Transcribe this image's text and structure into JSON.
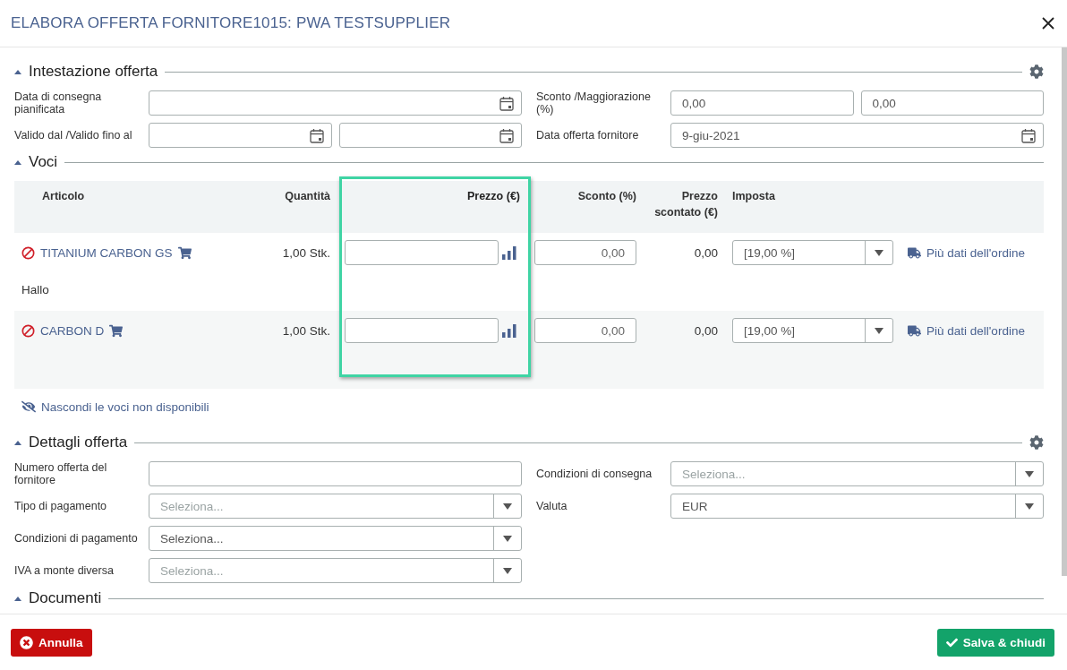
{
  "dialog": {
    "title": "ELABORA OFFERTA FORNITORE1015: PWA TESTSUPPLIER"
  },
  "header_section": {
    "title": "Intestazione offerta",
    "expanded": true,
    "left_fields": [
      {
        "label": "Data di consegna pianificata",
        "inputs": [
          {
            "kind": "date"
          }
        ]
      },
      {
        "label": "Valido dal /Valido fino al",
        "inputs": [
          {
            "kind": "date"
          },
          {
            "kind": "date"
          }
        ]
      }
    ],
    "right_fields": [
      {
        "label": "Sconto /Maggiorazione (%)",
        "inputs": [
          {
            "kind": "number",
            "value": "0,00"
          },
          {
            "kind": "number",
            "value": "0,00"
          }
        ]
      },
      {
        "label": "Data offerta fornitore",
        "inputs": [
          {
            "kind": "date",
            "value": "9-giu-2021"
          }
        ]
      }
    ]
  },
  "items_section": {
    "title": "Voci",
    "expanded": true,
    "columns": [
      {
        "label": "Articolo",
        "highlighted": false
      },
      {
        "label": "Quantità",
        "highlighted": false
      },
      {
        "label": "Prezzo (€)",
        "highlighted": true
      },
      {
        "label": "Sconto (%)",
        "highlighted": false
      },
      {
        "label": "Prezzo scontato (€)",
        "highlighted": false
      },
      {
        "label": "Imposta",
        "highlighted": false
      }
    ],
    "rows": [
      {
        "article": "TITANIUM CARBON GS",
        "unavailable": true,
        "quantity": "1,00 Stk.",
        "discount": "0,00",
        "discounted_price": "0,00",
        "tax": "[19,00 %]",
        "link": "Più dati dell'ordine",
        "note": "Hallo"
      },
      {
        "article": "CARBON D",
        "unavailable": true,
        "quantity": "1,00 Stk.",
        "discount": "0,00",
        "discounted_price": "0,00",
        "tax": "[19,00 %]",
        "link": "Più dati dell'ordine"
      }
    ],
    "toggle_link": "Nascondi le voci non disponibili"
  },
  "details_section": {
    "title": "Dettagli offerta",
    "expanded": true,
    "left_fields": [
      {
        "label": "Numero offerta del fornitore",
        "inputs": [
          {
            "kind": "text"
          }
        ]
      },
      {
        "label": "Tipo di pagamento",
        "inputs": [
          {
            "kind": "select",
            "placeholder": "Seleziona..."
          }
        ]
      },
      {
        "label": "Condizioni di pagamento",
        "inputs": [
          {
            "kind": "select",
            "value": "Seleziona..."
          }
        ]
      },
      {
        "label": "IVA a monte diversa",
        "inputs": [
          {
            "kind": "select",
            "placeholder": "Seleziona..."
          }
        ]
      }
    ],
    "right_fields": [
      {
        "label": "Condizioni di consegna",
        "inputs": [
          {
            "kind": "select",
            "placeholder": "Seleziona..."
          }
        ]
      },
      {
        "label": "Valuta",
        "inputs": [
          {
            "kind": "select",
            "value": "EUR"
          }
        ]
      }
    ]
  },
  "documents_section": {
    "title": "Documenti",
    "expanded": true
  },
  "footer": {
    "buttons": [
      {
        "label": "Annulla",
        "kind": "cancel"
      },
      {
        "label": "Salva & chiudi",
        "kind": "save"
      }
    ]
  }
}
